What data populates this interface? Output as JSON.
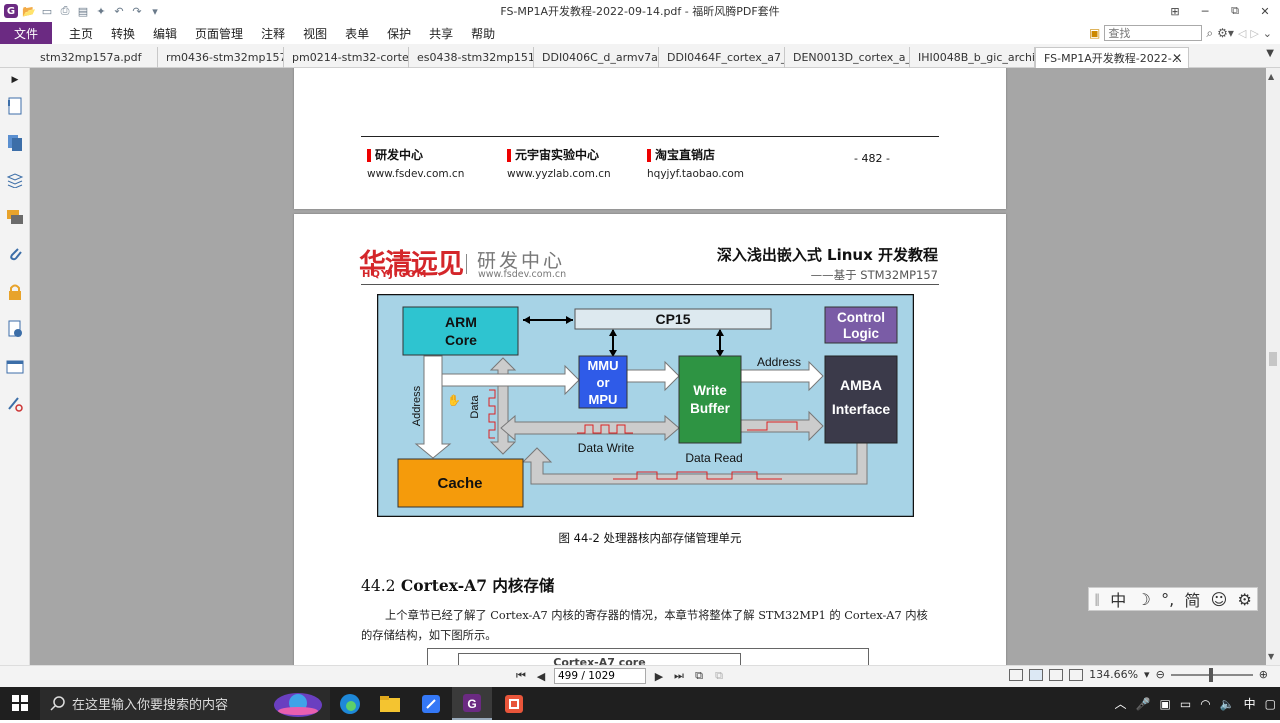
{
  "window": {
    "title": "FS-MP1A开发教程-2022-09-14.pdf - 福昕风腾PDF套件"
  },
  "menu": {
    "file": "文件",
    "items": [
      "主页",
      "转换",
      "编辑",
      "页面管理",
      "注释",
      "视图",
      "表单",
      "保护",
      "共享",
      "帮助"
    ],
    "search_placeholder": "查找"
  },
  "tabs": [
    {
      "label": "stm32mp157a.pdf"
    },
    {
      "label": "rm0436-stm32mp157-..."
    },
    {
      "label": "pm0214-stm32-cortex..."
    },
    {
      "label": "es0438-stm32mp151x..."
    },
    {
      "label": "DDI0406C_d_armv7ar..."
    },
    {
      "label": "DDI0464F_cortex_a7_..."
    },
    {
      "label": "DEN0013D_cortex_a_s..."
    },
    {
      "label": "IHI0048B_b_gic_archit..."
    },
    {
      "label": "FS-MP1A开发教程-2022-...",
      "active": true
    }
  ],
  "page_footer": {
    "cols": [
      {
        "head": "研发中心",
        "url": "www.fsdev.com.cn"
      },
      {
        "head": "元宇宙实验中心",
        "url": "www.yyzlab.com.cn"
      },
      {
        "head": "淘宝直销店",
        "url": "hqyjyf.taobao.com"
      }
    ],
    "page_number": "- 482 -"
  },
  "page_header": {
    "brand_cn": "华清远见",
    "brand_en": "HQYJ.COM",
    "center_cn": "研发中心",
    "center_url": "www.fsdev.com.cn",
    "book_title": "深入浅出嵌入式 Linux 开发教程",
    "book_subtitle": "——基于 STM32MP157"
  },
  "figure": {
    "labels": {
      "arm_core": [
        "ARM",
        "Core"
      ],
      "cp15": "CP15",
      "control_logic": [
        "Control",
        "Logic"
      ],
      "mmu": [
        "MMU",
        "or",
        "MPU"
      ],
      "write_buffer": [
        "Write",
        "Buffer"
      ],
      "amba": [
        "AMBA",
        "Interface"
      ],
      "cache": "Cache",
      "address_v": "Address",
      "data_v": "Data",
      "address_h": "Address",
      "data_write": "Data Write",
      "data_read": "Data Read"
    },
    "caption": "图 44-2 处理器核内部存储管理单元"
  },
  "section": {
    "number": "44.2",
    "title": "Cortex-A7 内核存储",
    "paragraph": "上个章节已经了解了 Cortex-A7 内核的寄存器的情况，本章节将整体了解 STM32MP1 的 Cortex-A7 内核的存储结构，如下图所示。",
    "next_figure_label": "Cortex-A7 core"
  },
  "status": {
    "page_field": "499 / 1029",
    "zoom": "134.66%"
  },
  "ime": {
    "items": [
      "中",
      "☽",
      "°,",
      "简",
      "☺",
      "⚙"
    ]
  },
  "taskbar": {
    "search_placeholder": "在这里输入你要搜索的内容",
    "tray_lang": "中"
  },
  "colors": {
    "brand_purple": "#6b2a82",
    "figure_bg": "#a7d3e6",
    "arm_core": "#2ec4d0",
    "mmu": "#2f5be8",
    "write_buffer": "#2e9443",
    "amba": "#3b3a4a",
    "cache": "#f59b0b",
    "control_logic": "#7a5ca6"
  }
}
